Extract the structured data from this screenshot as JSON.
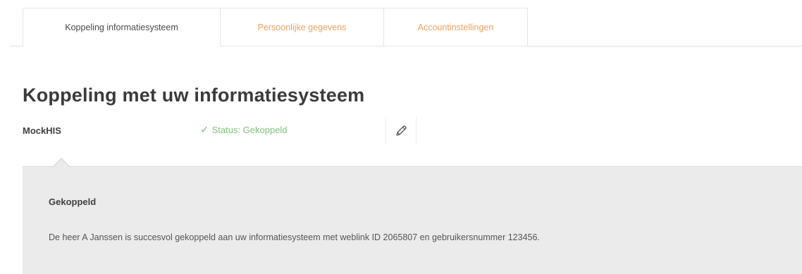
{
  "tabs": [
    {
      "label": "Koppeling informatiesysteem",
      "active": true
    },
    {
      "label": "Persoonlijke gegevens",
      "active": false
    },
    {
      "label": "Accountinstellingen",
      "active": false
    }
  ],
  "page": {
    "title": "Koppeling met uw informatiesysteem"
  },
  "system": {
    "name": "MockHIS",
    "status_label": "Status: Gekoppeld",
    "status_icon": "check-icon",
    "edit_icon": "pencil-icon"
  },
  "panel": {
    "title": "Gekoppeld",
    "message": "De heer A Janssen is succesvol gekoppeld aan uw informatiesysteem met weblink ID 2065807 en gebruikersnummer 123456."
  },
  "colors": {
    "accent_orange": "#f0a25b",
    "status_green": "#7fc37a",
    "panel_bg": "#ebebeb"
  }
}
